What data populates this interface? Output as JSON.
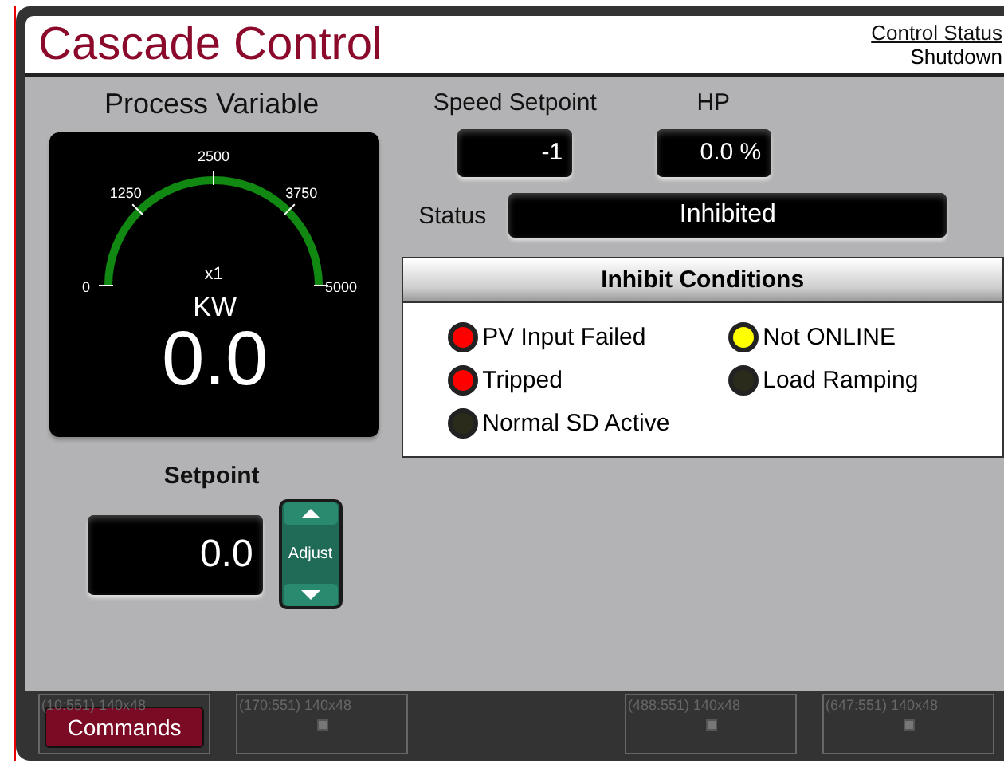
{
  "header": {
    "title": "Cascade Control",
    "status_link": "Control Status",
    "status_value": "Shutdown"
  },
  "process_variable": {
    "title": "Process Variable",
    "ticks": [
      "0",
      "1250",
      "2500",
      "3750",
      "5000"
    ],
    "multiplier": "x1",
    "unit": "KW",
    "value": "0.0"
  },
  "speed_setpoint": {
    "label": "Speed Setpoint",
    "value": "-1"
  },
  "hp": {
    "label": "HP",
    "value": "0.0 %"
  },
  "status": {
    "label": "Status",
    "value": "Inhibited"
  },
  "inhibit_conditions": {
    "title": "Inhibit Conditions",
    "items": [
      {
        "label": "PV Input Failed",
        "color": "#ff0000"
      },
      {
        "label": "Tripped",
        "color": "#ff0000"
      },
      {
        "label": "Normal SD Active",
        "color": "#2b2b1c"
      },
      {
        "label": "Not ONLINE",
        "color": "#ffff00"
      },
      {
        "label": "Load Ramping",
        "color": "#2b2b1c"
      }
    ]
  },
  "setpoint": {
    "label": "Setpoint",
    "value": "0.0",
    "adjust_label": "Adjust"
  },
  "footer_slots": [
    {
      "label": "(10:551) 140x48",
      "button": "Commands"
    },
    {
      "label": "(170:551) 140x48"
    },
    {
      "label": "(488:551) 140x48"
    },
    {
      "label": "(647:551) 140x48"
    }
  ]
}
